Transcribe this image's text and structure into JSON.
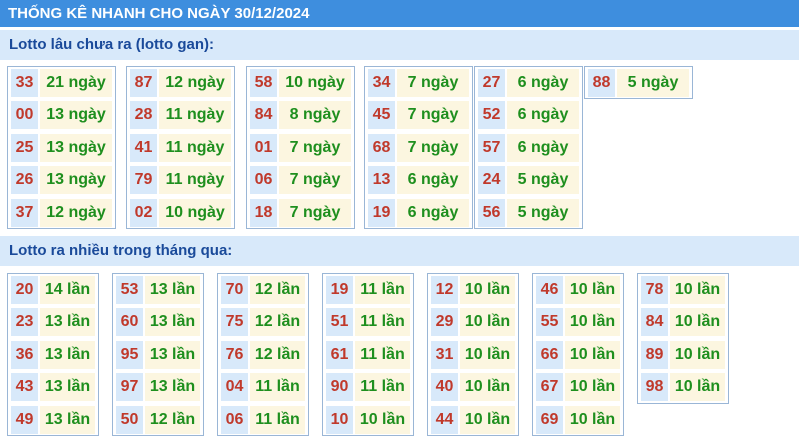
{
  "header": {
    "title": "THỐNG KÊ NHANH CHO NGÀY 30/12/2024"
  },
  "gan": {
    "heading": "Lotto lâu chưa ra (lotto gan):",
    "columns": [
      [
        [
          "33",
          "21 ngày"
        ],
        [
          "00",
          "13 ngày"
        ],
        [
          "25",
          "13 ngày"
        ],
        [
          "26",
          "13 ngày"
        ],
        [
          "37",
          "12 ngày"
        ]
      ],
      [
        [
          "87",
          "12 ngày"
        ],
        [
          "28",
          "11 ngày"
        ],
        [
          "41",
          "11 ngày"
        ],
        [
          "79",
          "11 ngày"
        ],
        [
          "02",
          "10 ngày"
        ]
      ],
      [
        [
          "58",
          "10 ngày"
        ],
        [
          "84",
          "8 ngày"
        ],
        [
          "01",
          "7 ngày"
        ],
        [
          "06",
          "7 ngày"
        ],
        [
          "18",
          "7 ngày"
        ]
      ],
      [
        [
          "34",
          "7 ngày"
        ],
        [
          "45",
          "7 ngày"
        ],
        [
          "68",
          "7 ngày"
        ],
        [
          "13",
          "6 ngày"
        ],
        [
          "19",
          "6 ngày"
        ]
      ],
      [
        [
          "27",
          "6 ngày"
        ],
        [
          "52",
          "6 ngày"
        ],
        [
          "57",
          "6 ngày"
        ],
        [
          "24",
          "5 ngày"
        ],
        [
          "56",
          "5 ngày"
        ]
      ],
      [
        [
          "88",
          "5 ngày"
        ]
      ]
    ]
  },
  "nhieu": {
    "heading": "Lotto ra nhiều trong tháng qua:",
    "columns": [
      [
        [
          "20",
          "14 lần"
        ],
        [
          "23",
          "13 lần"
        ],
        [
          "36",
          "13 lần"
        ],
        [
          "43",
          "13 lần"
        ],
        [
          "49",
          "13 lần"
        ]
      ],
      [
        [
          "53",
          "13 lần"
        ],
        [
          "60",
          "13 lần"
        ],
        [
          "95",
          "13 lần"
        ],
        [
          "97",
          "13 lần"
        ],
        [
          "50",
          "12 lần"
        ]
      ],
      [
        [
          "70",
          "12 lần"
        ],
        [
          "75",
          "12 lần"
        ],
        [
          "76",
          "12 lần"
        ],
        [
          "04",
          "11 lần"
        ],
        [
          "06",
          "11 lần"
        ]
      ],
      [
        [
          "19",
          "11 lần"
        ],
        [
          "51",
          "11 lần"
        ],
        [
          "61",
          "11 lần"
        ],
        [
          "90",
          "11 lần"
        ],
        [
          "10",
          "10 lần"
        ]
      ],
      [
        [
          "12",
          "10 lần"
        ],
        [
          "29",
          "10 lần"
        ],
        [
          "31",
          "10 lần"
        ],
        [
          "40",
          "10 lần"
        ],
        [
          "44",
          "10 lần"
        ]
      ],
      [
        [
          "46",
          "10 lần"
        ],
        [
          "55",
          "10 lần"
        ],
        [
          "66",
          "10 lần"
        ],
        [
          "67",
          "10 lần"
        ],
        [
          "69",
          "10 lần"
        ]
      ],
      [
        [
          "78",
          "10 lần"
        ],
        [
          "84",
          "10 lần"
        ],
        [
          "89",
          "10 lần"
        ],
        [
          "98",
          "10 lần"
        ]
      ]
    ]
  }
}
